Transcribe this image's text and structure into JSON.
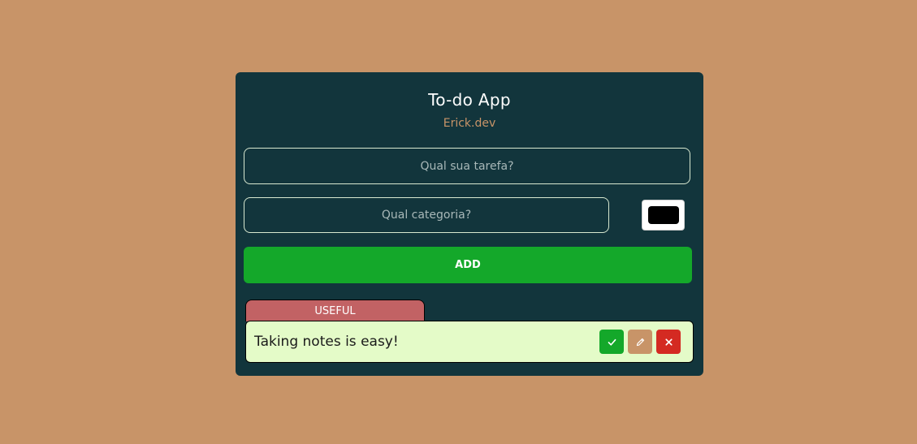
{
  "app": {
    "title": "To-do App",
    "subtitle": "Erick.dev"
  },
  "form": {
    "task_placeholder": "Qual sua tarefa?",
    "category_placeholder": "Qual categoria?",
    "color_value": "#000000",
    "add_label": "ADD"
  },
  "tasks": [
    {
      "category": "USEFUL",
      "category_color": "#c26264",
      "text": "Taking notes is easy!",
      "actions": [
        "check-icon",
        "pencil-icon",
        "close-icon"
      ]
    }
  ],
  "colors": {
    "page_background": "#c89468",
    "card_background": "#12353c",
    "accent": "#c89468",
    "add_button": "#14a82a",
    "task_background": "#e4fbc8",
    "done_button": "#14a82a",
    "edit_button": "#c89468",
    "delete_button": "#d42a22"
  }
}
